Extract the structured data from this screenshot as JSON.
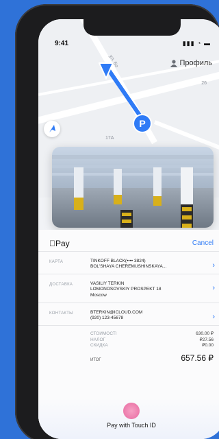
{
  "status": {
    "time": "9:41",
    "icons": "▮▮▮ ◔ ▬"
  },
  "header": {
    "profile_label": "Профиль"
  },
  "map": {
    "street_label": "ул. Бо",
    "house_26": "26",
    "house_17a": "17А",
    "parking_letter": "P"
  },
  "payment": {
    "apple_pay_label": "Pay",
    "cancel_label": "Cancel",
    "rows": [
      {
        "label": "КАРТА",
        "lines": [
          "TINKOFF BLACK(•••• 3824)",
          "BOL'SHAYA CHEREMUSHINSKAYA..."
        ]
      },
      {
        "label": "ДОСТАВКА",
        "lines": [
          "VASILIY TERKIN",
          "LOMONOSOVSKIY PROSPEKT 18",
          "Moscow"
        ]
      },
      {
        "label": "КОНТАКТЫ",
        "lines": [
          "BTERKIN@ICLOUD.COM",
          "(920) 123-45678"
        ]
      }
    ],
    "totals": [
      {
        "label": "СТОИМОСТI",
        "amount": "630.00 ₽"
      },
      {
        "label": "НАЛОГ",
        "amount": "₽27.56"
      },
      {
        "label": "СКИДКА",
        "amount": "₽0.00"
      }
    ],
    "total_label": "ИТОГ",
    "total_amount": "657.56 ₽",
    "touch_id_label": "Pay with Touch ID"
  }
}
